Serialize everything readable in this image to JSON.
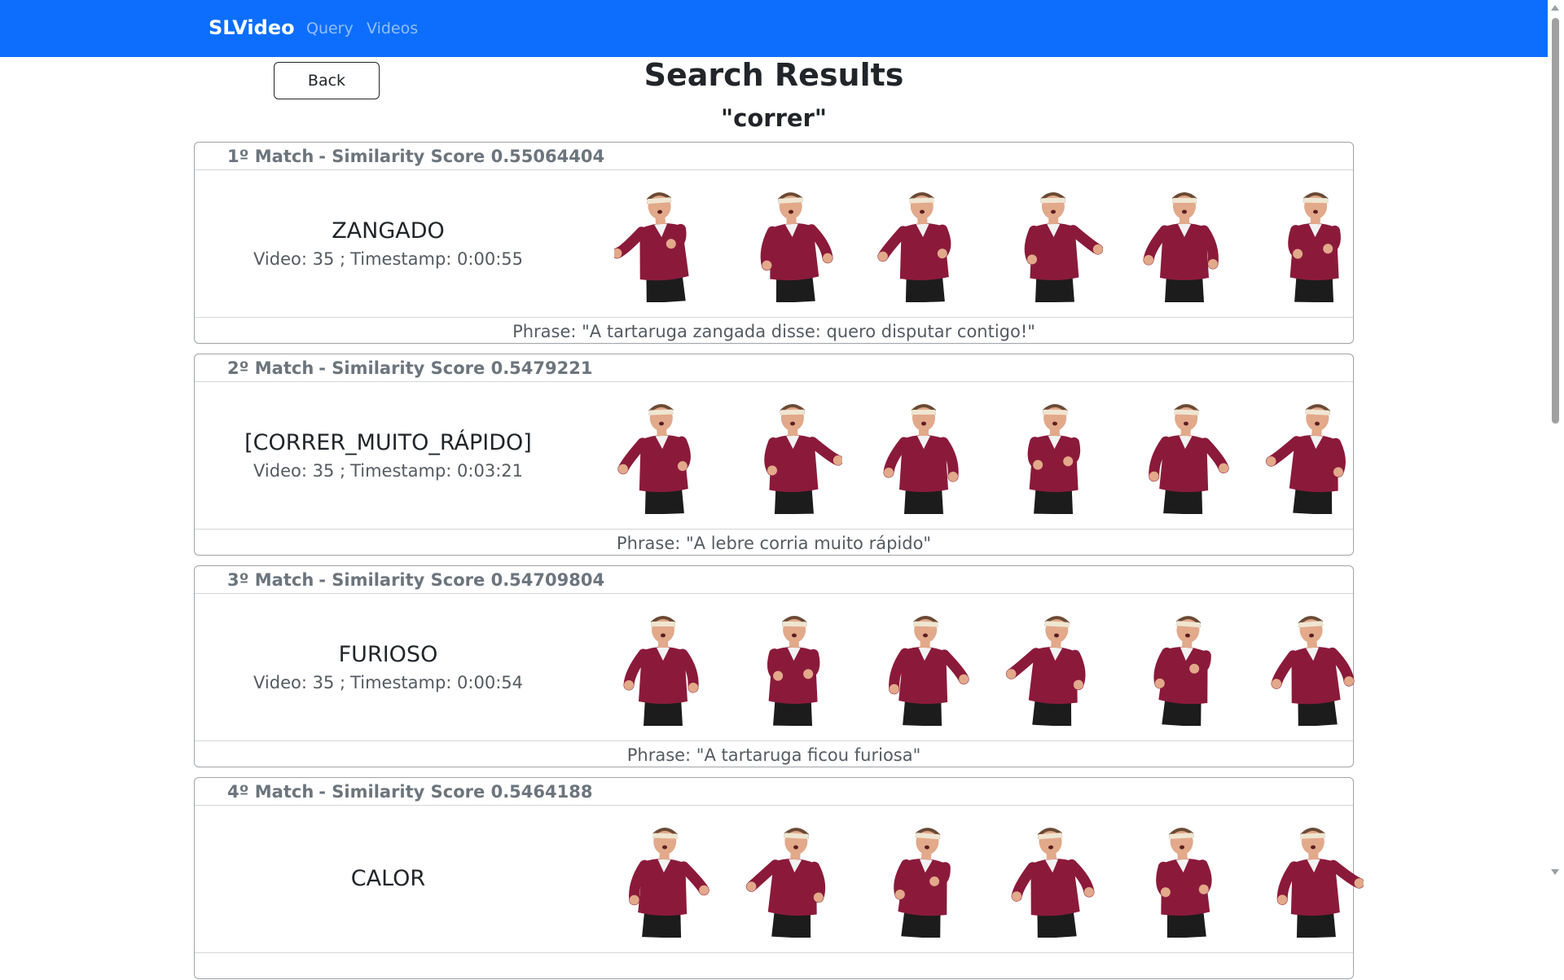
{
  "navbar": {
    "brand": "SLVideo",
    "links": [
      "Query",
      "Videos"
    ],
    "background": "#0d6efd"
  },
  "page": {
    "back_label": "Back",
    "title": "Search Results",
    "query": "\"correr\""
  },
  "results": [
    {
      "rank": "1º Match",
      "score_label": "- Similarity Score 0.55064404",
      "gloss": "ZANGADO",
      "video": "Video: 35 ;",
      "timestamp": "Timestamp: 0:00:55",
      "phrase": "Phrase: \"A tartaruga zangada disse: quero disputar contigo!\"",
      "frame_count": 6
    },
    {
      "rank": "2º Match",
      "score_label": "- Similarity Score 0.5479221",
      "gloss": "[CORRER_MUITO_RÁPIDO]",
      "video": "Video: 35 ;",
      "timestamp": "Timestamp: 0:03:21",
      "phrase": "Phrase: \"A lebre corria muito rápido\"",
      "frame_count": 6
    },
    {
      "rank": "3º Match",
      "score_label": "- Similarity Score 0.54709804",
      "gloss": "FURIOSO",
      "video": "Video: 35 ;",
      "timestamp": "Timestamp: 0:00:54",
      "phrase": "Phrase: \"A tartaruga ficou furiosa\"",
      "frame_count": 6
    },
    {
      "rank": "4º Match",
      "score_label": "- Similarity Score 0.5464188",
      "gloss": "CALOR",
      "video": "",
      "timestamp": "",
      "phrase": "",
      "frame_count": 6
    }
  ],
  "colors": {
    "shirt": "#8b1a3a",
    "pants": "#1c1c1c",
    "skin": "#e2a98a",
    "hair": "#6b4a35",
    "headband": "#efe6d2"
  }
}
